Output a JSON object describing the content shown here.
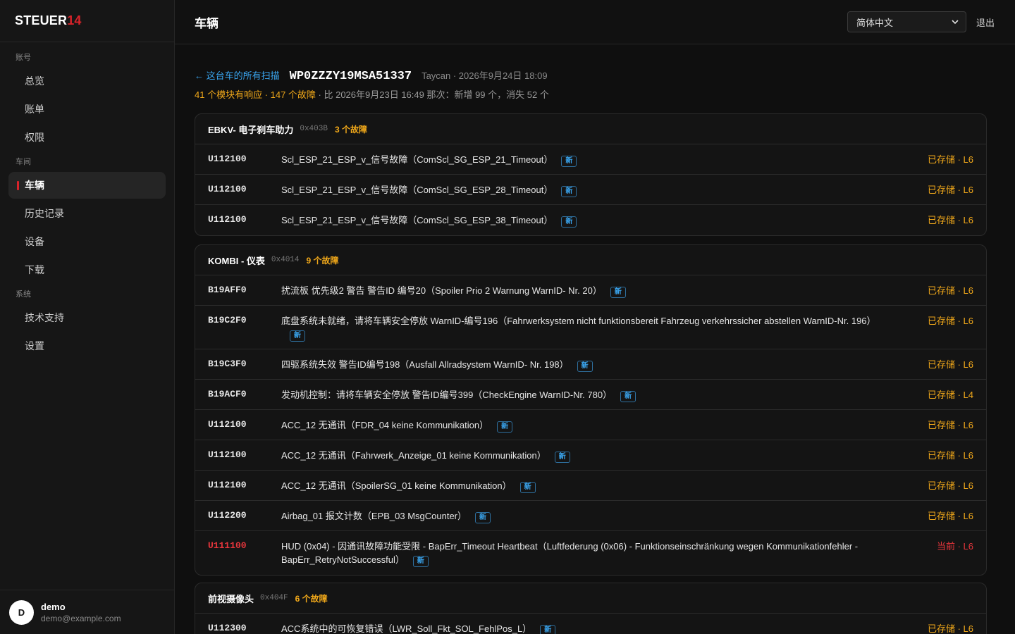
{
  "app": {
    "logo_main": "STEUER",
    "logo_accent": "14"
  },
  "sidebar": {
    "sections": [
      {
        "label": "账号",
        "items": [
          "总览",
          "账单",
          "权限"
        ]
      },
      {
        "label": "车间",
        "items": [
          "车辆",
          "历史记录",
          "设备",
          "下载"
        ]
      },
      {
        "label": "系统",
        "items": [
          "技术支持",
          "设置"
        ]
      }
    ],
    "active": "车辆"
  },
  "user": {
    "initial": "D",
    "name": "demo",
    "email": "demo@example.com"
  },
  "header": {
    "title": "车辆",
    "language": "简体中文",
    "logout": "退出"
  },
  "scan": {
    "back_link": "← 这台车的所有扫描",
    "vin": "WP0ZZZY19MSA51337",
    "meta": "Taycan · 2026年9月24日 18:09",
    "summary_warn": "41 个模块有响应 · 147 个故障",
    "summary_rest": " · 比 2026年9月23日 16:49 那次：新增 99 个，消失 52 个"
  },
  "new_badge": "新",
  "modules": [
    {
      "name": "EBKV- 电子刹车助力",
      "address": "0x403B",
      "count": "3 个故障",
      "faults": [
        {
          "code": "U112100",
          "desc": "Scl_ESP_21_ESP_v_信号故障（ComScl_SG_ESP_21_Timeout）",
          "status": "已存储 · L6",
          "red": false
        },
        {
          "code": "U112100",
          "desc": "Scl_ESP_21_ESP_v_信号故障（ComScl_SG_ESP_28_Timeout）",
          "status": "已存储 · L6",
          "red": false
        },
        {
          "code": "U112100",
          "desc": "Scl_ESP_21_ESP_v_信号故障（ComScl_SG_ESP_38_Timeout）",
          "status": "已存储 · L6",
          "red": false
        }
      ]
    },
    {
      "name": "KOMBI - 仪表",
      "address": "0x4014",
      "count": "9 个故障",
      "faults": [
        {
          "code": "B19AFF0",
          "desc": "扰流板 优先级2 警告 警告ID 编号20（Spoiler Prio 2 Warnung WarnID- Nr. 20）",
          "status": "已存储 · L6",
          "red": false
        },
        {
          "code": "B19C2F0",
          "desc": "底盘系统未就绪，请将车辆安全停放 WarnID-编号196（Fahrwerksystem nicht funktionsbereit Fahrzeug verkehrssicher abstellen WarnID-Nr. 196）",
          "status": "已存储 · L6",
          "red": false
        },
        {
          "code": "B19C3F0",
          "desc": "四驱系统失效 警告ID编号198（Ausfall Allradsystem WarnID- Nr. 198）",
          "status": "已存储 · L6",
          "red": false
        },
        {
          "code": "B19ACF0",
          "desc": "发动机控制：请将车辆安全停放 警告ID编号399（CheckEngine WarnID-Nr. 780）",
          "status": "已存储 · L4",
          "red": false
        },
        {
          "code": "U112100",
          "desc": "ACC_12 无通讯（FDR_04 keine Kommunikation）",
          "status": "已存储 · L6",
          "red": false
        },
        {
          "code": "U112100",
          "desc": "ACC_12 无通讯（Fahrwerk_Anzeige_01 keine Kommunikation）",
          "status": "已存储 · L6",
          "red": false
        },
        {
          "code": "U112100",
          "desc": "ACC_12 无通讯（SpoilerSG_01 keine Kommunikation）",
          "status": "已存储 · L6",
          "red": false
        },
        {
          "code": "U112200",
          "desc": "Airbag_01 报文计数（EPB_03 MsgCounter）",
          "status": "已存储 · L6",
          "red": false
        },
        {
          "code": "U111100",
          "desc": "HUD (0x04) - 因通讯故障功能受限 - BapErr_Timeout Heartbeat（Luftfederung (0x06) - Funktionseinschränkung wegen Kommunikationfehler - BapErr_RetryNotSuccessful）",
          "status": "当前 · L6",
          "red": true
        }
      ]
    },
    {
      "name": "前视摄像头",
      "address": "0x404F",
      "count": "6 个故障",
      "faults": [
        {
          "code": "U112300",
          "desc": "ACC系统中的可恢复错误（LWR_Soll_Fkt_SOL_FehlPos_L）",
          "status": "已存储 · L6",
          "red": false
        }
      ]
    }
  ]
}
